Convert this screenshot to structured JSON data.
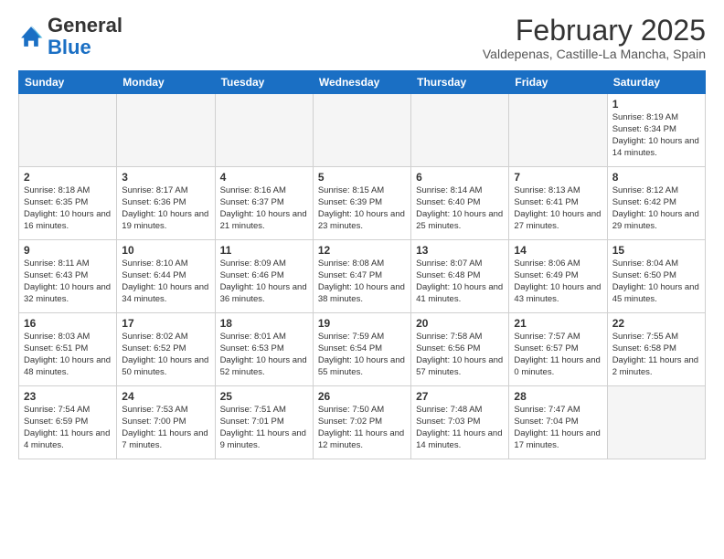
{
  "header": {
    "logo_general": "General",
    "logo_blue": "Blue",
    "month_title": "February 2025",
    "location": "Valdepenas, Castille-La Mancha, Spain"
  },
  "weekdays": [
    "Sunday",
    "Monday",
    "Tuesday",
    "Wednesday",
    "Thursday",
    "Friday",
    "Saturday"
  ],
  "weeks": [
    [
      {
        "day": "",
        "info": ""
      },
      {
        "day": "",
        "info": ""
      },
      {
        "day": "",
        "info": ""
      },
      {
        "day": "",
        "info": ""
      },
      {
        "day": "",
        "info": ""
      },
      {
        "day": "",
        "info": ""
      },
      {
        "day": "1",
        "info": "Sunrise: 8:19 AM\nSunset: 6:34 PM\nDaylight: 10 hours and 14 minutes."
      }
    ],
    [
      {
        "day": "2",
        "info": "Sunrise: 8:18 AM\nSunset: 6:35 PM\nDaylight: 10 hours and 16 minutes."
      },
      {
        "day": "3",
        "info": "Sunrise: 8:17 AM\nSunset: 6:36 PM\nDaylight: 10 hours and 19 minutes."
      },
      {
        "day": "4",
        "info": "Sunrise: 8:16 AM\nSunset: 6:37 PM\nDaylight: 10 hours and 21 minutes."
      },
      {
        "day": "5",
        "info": "Sunrise: 8:15 AM\nSunset: 6:39 PM\nDaylight: 10 hours and 23 minutes."
      },
      {
        "day": "6",
        "info": "Sunrise: 8:14 AM\nSunset: 6:40 PM\nDaylight: 10 hours and 25 minutes."
      },
      {
        "day": "7",
        "info": "Sunrise: 8:13 AM\nSunset: 6:41 PM\nDaylight: 10 hours and 27 minutes."
      },
      {
        "day": "8",
        "info": "Sunrise: 8:12 AM\nSunset: 6:42 PM\nDaylight: 10 hours and 29 minutes."
      }
    ],
    [
      {
        "day": "9",
        "info": "Sunrise: 8:11 AM\nSunset: 6:43 PM\nDaylight: 10 hours and 32 minutes."
      },
      {
        "day": "10",
        "info": "Sunrise: 8:10 AM\nSunset: 6:44 PM\nDaylight: 10 hours and 34 minutes."
      },
      {
        "day": "11",
        "info": "Sunrise: 8:09 AM\nSunset: 6:46 PM\nDaylight: 10 hours and 36 minutes."
      },
      {
        "day": "12",
        "info": "Sunrise: 8:08 AM\nSunset: 6:47 PM\nDaylight: 10 hours and 38 minutes."
      },
      {
        "day": "13",
        "info": "Sunrise: 8:07 AM\nSunset: 6:48 PM\nDaylight: 10 hours and 41 minutes."
      },
      {
        "day": "14",
        "info": "Sunrise: 8:06 AM\nSunset: 6:49 PM\nDaylight: 10 hours and 43 minutes."
      },
      {
        "day": "15",
        "info": "Sunrise: 8:04 AM\nSunset: 6:50 PM\nDaylight: 10 hours and 45 minutes."
      }
    ],
    [
      {
        "day": "16",
        "info": "Sunrise: 8:03 AM\nSunset: 6:51 PM\nDaylight: 10 hours and 48 minutes."
      },
      {
        "day": "17",
        "info": "Sunrise: 8:02 AM\nSunset: 6:52 PM\nDaylight: 10 hours and 50 minutes."
      },
      {
        "day": "18",
        "info": "Sunrise: 8:01 AM\nSunset: 6:53 PM\nDaylight: 10 hours and 52 minutes."
      },
      {
        "day": "19",
        "info": "Sunrise: 7:59 AM\nSunset: 6:54 PM\nDaylight: 10 hours and 55 minutes."
      },
      {
        "day": "20",
        "info": "Sunrise: 7:58 AM\nSunset: 6:56 PM\nDaylight: 10 hours and 57 minutes."
      },
      {
        "day": "21",
        "info": "Sunrise: 7:57 AM\nSunset: 6:57 PM\nDaylight: 11 hours and 0 minutes."
      },
      {
        "day": "22",
        "info": "Sunrise: 7:55 AM\nSunset: 6:58 PM\nDaylight: 11 hours and 2 minutes."
      }
    ],
    [
      {
        "day": "23",
        "info": "Sunrise: 7:54 AM\nSunset: 6:59 PM\nDaylight: 11 hours and 4 minutes."
      },
      {
        "day": "24",
        "info": "Sunrise: 7:53 AM\nSunset: 7:00 PM\nDaylight: 11 hours and 7 minutes."
      },
      {
        "day": "25",
        "info": "Sunrise: 7:51 AM\nSunset: 7:01 PM\nDaylight: 11 hours and 9 minutes."
      },
      {
        "day": "26",
        "info": "Sunrise: 7:50 AM\nSunset: 7:02 PM\nDaylight: 11 hours and 12 minutes."
      },
      {
        "day": "27",
        "info": "Sunrise: 7:48 AM\nSunset: 7:03 PM\nDaylight: 11 hours and 14 minutes."
      },
      {
        "day": "28",
        "info": "Sunrise: 7:47 AM\nSunset: 7:04 PM\nDaylight: 11 hours and 17 minutes."
      },
      {
        "day": "",
        "info": ""
      }
    ]
  ]
}
